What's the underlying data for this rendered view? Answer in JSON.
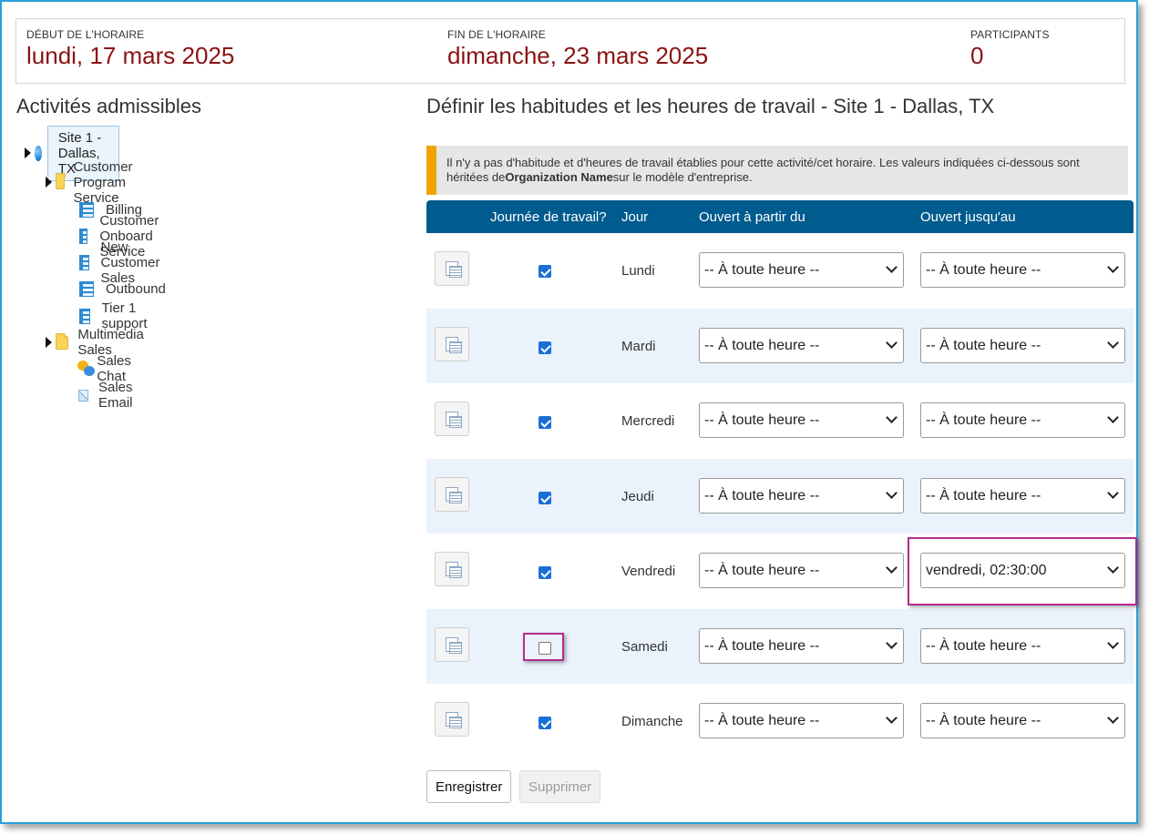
{
  "header": {
    "start_label": "DÉBUT DE L'HORAIRE",
    "start_value": "lundi, 17 mars 2025",
    "end_label": "FIN DE L'HORAIRE",
    "end_value": "dimanche, 23 mars 2025",
    "participants_label": "PARTICIPANTS",
    "participants_value": "0"
  },
  "left": {
    "title": "Activités admissibles",
    "tree": {
      "site": "Site 1 - Dallas, TX",
      "group1": "Customer Program Service",
      "group1_items": [
        "Billing",
        "Customer Onboard Service",
        "New Customer Sales",
        "Outbound",
        "Tier 1 support"
      ],
      "group2": "Multimedia Sales",
      "group2_items": [
        "Sales Chat",
        "Sales Email"
      ]
    }
  },
  "right": {
    "title": "Définir les habitudes et les heures de travail - Site 1 - Dallas, TX",
    "notice_part1": "Il n'y a pas d'habitude et d'heures de travail établies pour cette activité/cet horaire. Les valeurs indiquées ci-dessous sont héritées de",
    "notice_bold": "Organization Name",
    "notice_part2": "sur le modèle d'entreprise.",
    "columns": {
      "workday": "Journée de travail?",
      "day": "Jour",
      "open_from": "Ouvert à partir du",
      "open_until": "Ouvert jusqu'au"
    },
    "rows": [
      {
        "day": "Lundi",
        "workday": true,
        "from": "-- À toute heure --",
        "until": "-- À toute heure --"
      },
      {
        "day": "Mardi",
        "workday": true,
        "from": "-- À toute heure --",
        "until": "-- À toute heure --"
      },
      {
        "day": "Mercredi",
        "workday": true,
        "from": "-- À toute heure --",
        "until": "-- À toute heure --"
      },
      {
        "day": "Jeudi",
        "workday": true,
        "from": "-- À toute heure --",
        "until": "-- À toute heure --"
      },
      {
        "day": "Vendredi",
        "workday": true,
        "from": "-- À toute heure --",
        "until": "vendredi, 02:30:00"
      },
      {
        "day": "Samedi",
        "workday": false,
        "from": "-- À toute heure --",
        "until": "-- À toute heure --"
      },
      {
        "day": "Dimanche",
        "workday": true,
        "from": "-- À toute heure --",
        "until": "-- À toute heure --"
      }
    ],
    "save_label": "Enregistrer",
    "delete_label": "Supprimer"
  },
  "colors": {
    "accent_header": "#005b8e",
    "date_value": "#8b1212",
    "highlight": "#b62a8f",
    "notice_bar": "#f0a300"
  }
}
